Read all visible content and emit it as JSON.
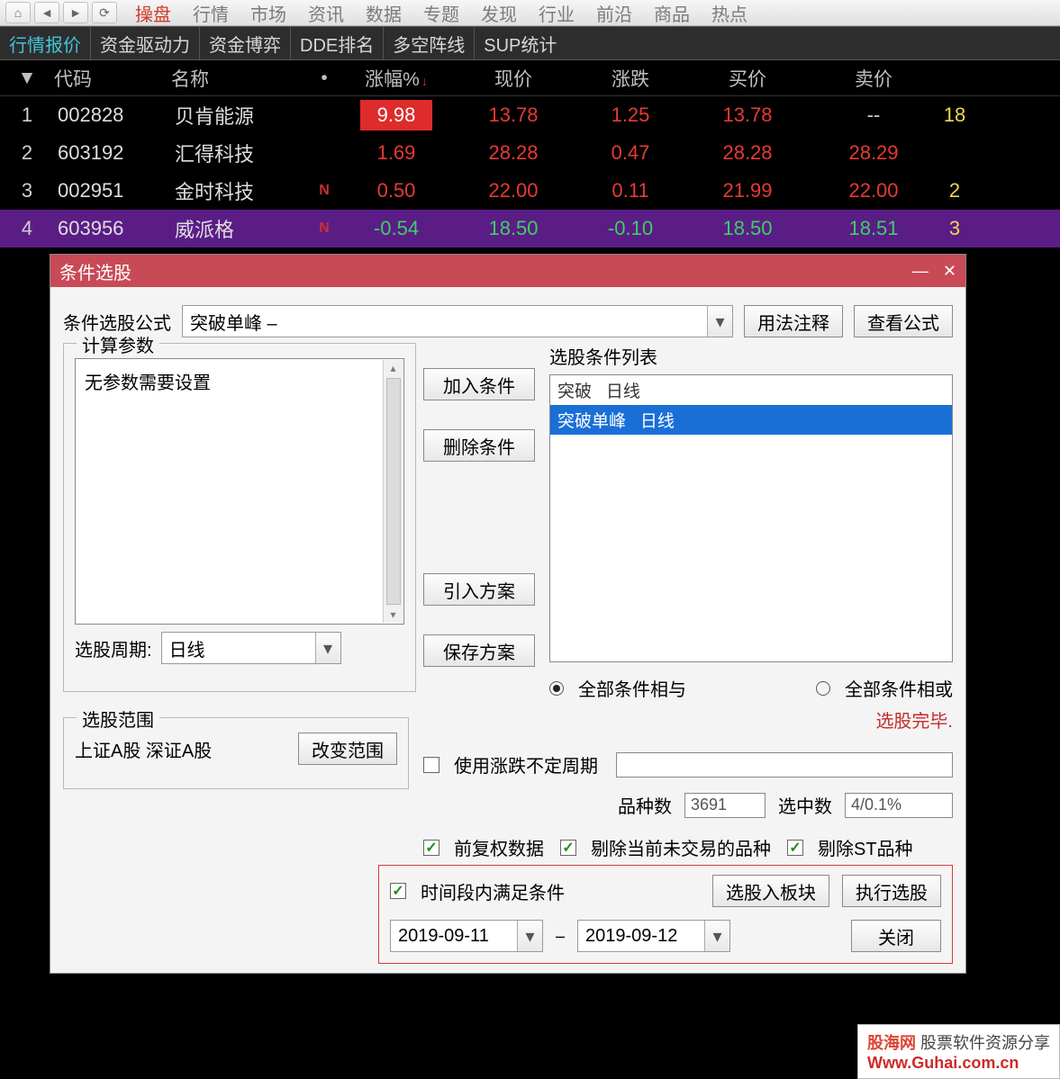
{
  "top_menu": [
    "操盘",
    "行情",
    "市场",
    "资讯",
    "数据",
    "专题",
    "发现",
    "行业",
    "前沿",
    "商品",
    "热点"
  ],
  "nav2": [
    "行情报价",
    "资金驱动力",
    "资金博弈",
    "DDE排名",
    "多空阵线",
    "SUP统计"
  ],
  "table": {
    "headers": [
      "",
      "代码",
      "名称",
      "",
      "涨幅%",
      "现价",
      "涨跌",
      "买价",
      "卖价",
      ""
    ],
    "rows": [
      {
        "idx": "1",
        "code": "002828",
        "name": "贝肯能源",
        "tag": "",
        "pct": "9.98",
        "pct_cls": "hi",
        "price": "13.78",
        "chg": "1.25",
        "bid": "13.78",
        "ask": "--",
        "ext": "18",
        "row_cls": "red"
      },
      {
        "idx": "2",
        "code": "603192",
        "name": "汇得科技",
        "tag": "",
        "pct": "1.69",
        "pct_cls": "red",
        "price": "28.28",
        "chg": "0.47",
        "bid": "28.28",
        "ask": "28.29",
        "ext": "",
        "row_cls": "red"
      },
      {
        "idx": "3",
        "code": "002951",
        "name": "金时科技",
        "tag": "N",
        "pct": "0.50",
        "pct_cls": "red",
        "price": "22.00",
        "chg": "0.11",
        "bid": "21.99",
        "ask": "22.00",
        "ext": "2",
        "row_cls": "red"
      },
      {
        "idx": "4",
        "code": "603956",
        "name": "威派格",
        "tag": "N",
        "pct": "-0.54",
        "pct_cls": "green",
        "price": "18.50",
        "chg": "-0.10",
        "bid": "18.50",
        "ask": "18.51",
        "ext": "3",
        "row_cls": "green",
        "sel": true
      }
    ]
  },
  "dialog": {
    "title": "条件选股",
    "formula_label": "条件选股公式",
    "formula_value": "突破单峰       –",
    "btn_usage": "用法注释",
    "btn_view": "查看公式",
    "calc_legend": "计算参数",
    "no_params": "无参数需要设置",
    "period_label": "选股周期:",
    "period_value": "日线",
    "btn_add": "加入条件",
    "btn_del": "删除条件",
    "btn_import": "引入方案",
    "btn_save": "保存方案",
    "list_title": "选股条件列表",
    "list_items": [
      {
        "text": "突破   日线",
        "sel": false
      },
      {
        "text": "突破单峰   日线",
        "sel": true
      }
    ],
    "radio_and": "全部条件相与",
    "radio_or": "全部条件相或",
    "status": "选股完毕.",
    "range_legend": "选股范围",
    "range_text": "上证A股 深证A股",
    "btn_change_range": "改变范围",
    "chk_variable": "使用涨跌不定周期",
    "lbl_count": "品种数",
    "val_count": "3691",
    "lbl_hit": "选中数",
    "val_hit": "4/0.1%",
    "chk_fq": "前复权数据",
    "chk_exclude_nontrading": "剔除当前未交易的品种",
    "chk_exclude_st": "剔除ST品种",
    "chk_time": "时间段内满足条件",
    "btn_into_block": "选股入板块",
    "btn_exec": "执行选股",
    "date_from": "2019-09-11",
    "date_sep": "–",
    "date_to": "2019-09-12",
    "btn_close": "关闭"
  },
  "watermark": {
    "site": "股海网",
    "desc": "股票软件资源分享",
    "url": "Www.Guhai.com.cn"
  }
}
